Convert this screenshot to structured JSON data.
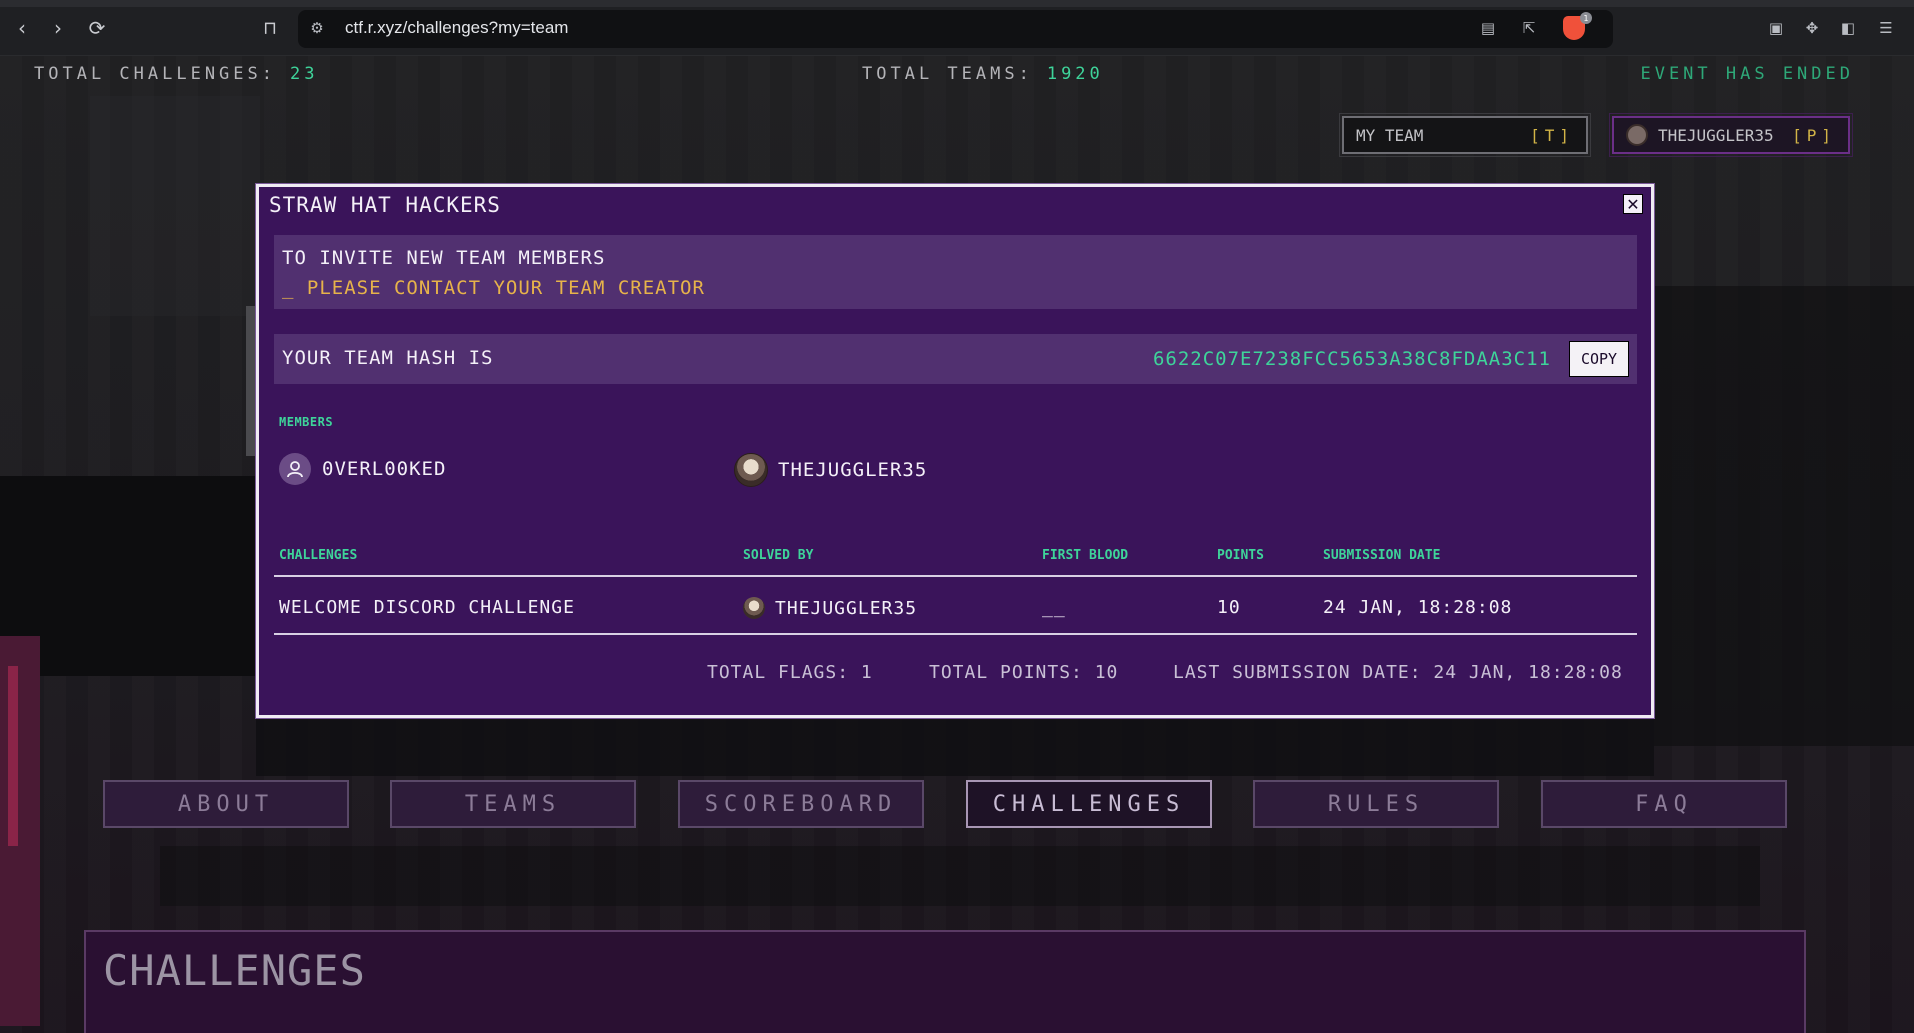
{
  "browser": {
    "url": "ctf.r.xyz/challenges?my=team",
    "back_icon": "‹",
    "forward_icon": "›",
    "reload_icon": "⟳",
    "badge_count": "1"
  },
  "header": {
    "total_challenges_label": "TOTAL CHALLENGES:",
    "total_challenges_value": "23",
    "total_teams_label": "TOTAL TEAMS:",
    "total_teams_value": "1920",
    "event_status": "EVENT HAS ENDED",
    "my_team_label": "MY TEAM",
    "my_team_key": "[T]",
    "user_label": "THEJUGGLER35",
    "user_key": "[P]"
  },
  "modal": {
    "title": "STRAW HAT HACKERS",
    "close_symbol": "✕",
    "invite_line1": "TO INVITE NEW TEAM MEMBERS",
    "invite_line2": "_ PLEASE CONTACT YOUR TEAM CREATOR",
    "hash_label": "YOUR TEAM HASH IS",
    "hash_value": "6622C07E7238FCC5653A38C8FDAA3C11",
    "copy_label": "COPY",
    "members_label": "MEMBERS",
    "members": [
      {
        "name": "0VERL00KED"
      },
      {
        "name": "THEJUGGLER35"
      }
    ],
    "table": {
      "headers": [
        "CHALLENGES",
        "SOLVED BY",
        "FIRST BLOOD",
        "POINTS",
        "SUBMISSION DATE"
      ],
      "rows": [
        {
          "challenge": "WELCOME DISCORD CHALLENGE",
          "solved_by": "THEJUGGLER35",
          "first_blood": "__",
          "points": "10",
          "date": "24 JAN, 18:28:08"
        }
      ]
    },
    "footer": {
      "total_flags": "TOTAL FLAGS: 1",
      "total_points": "TOTAL POINTS: 10",
      "last_submission": "LAST SUBMISSION DATE: 24 JAN, 18:28:08"
    }
  },
  "nav": {
    "tabs": [
      "ABOUT",
      "TEAMS",
      "SCOREBOARD",
      "CHALLENGES",
      "RULES",
      "FAQ"
    ],
    "active": "CHALLENGES"
  },
  "panel": {
    "title": "CHALLENGES"
  },
  "colors": {
    "accent_green": "#3ed49a",
    "accent_yellow": "#e7b34a",
    "modal_bg": "#3a145a"
  }
}
